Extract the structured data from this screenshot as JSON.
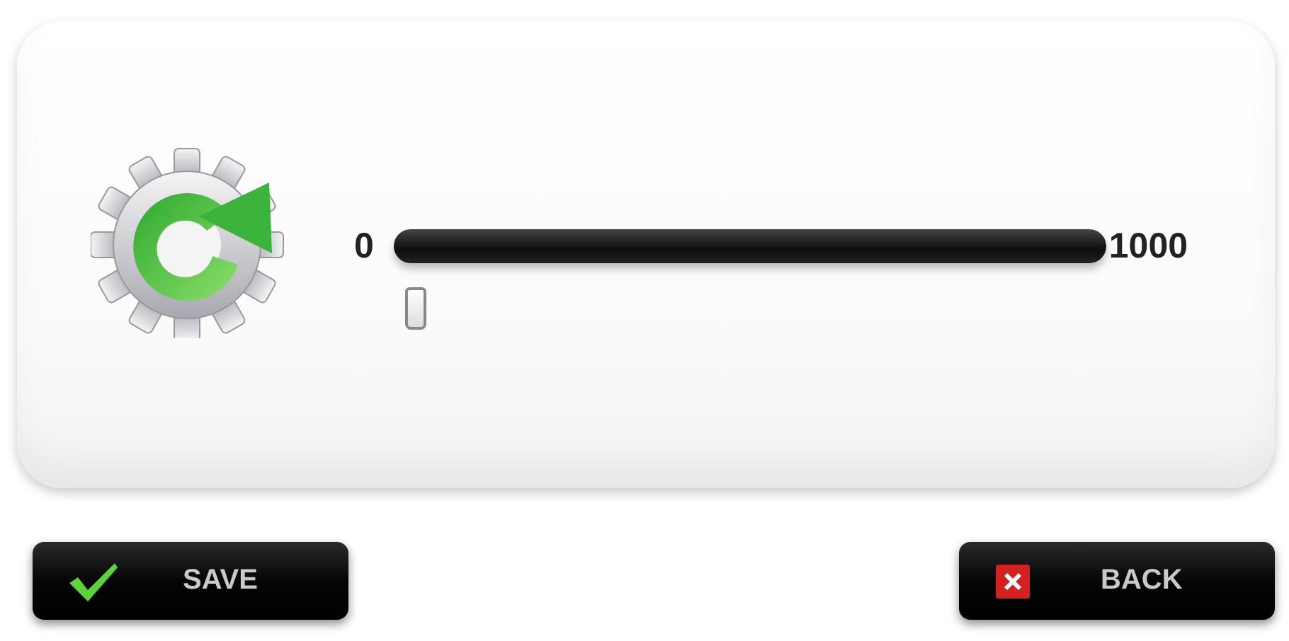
{
  "slider": {
    "min_label": "0",
    "max_label": "1000",
    "level": 0.03
  },
  "buttons": [
    {
      "label": "SAVE",
      "kind": "save"
    },
    {
      "label": "BACK",
      "kind": "back"
    }
  ]
}
